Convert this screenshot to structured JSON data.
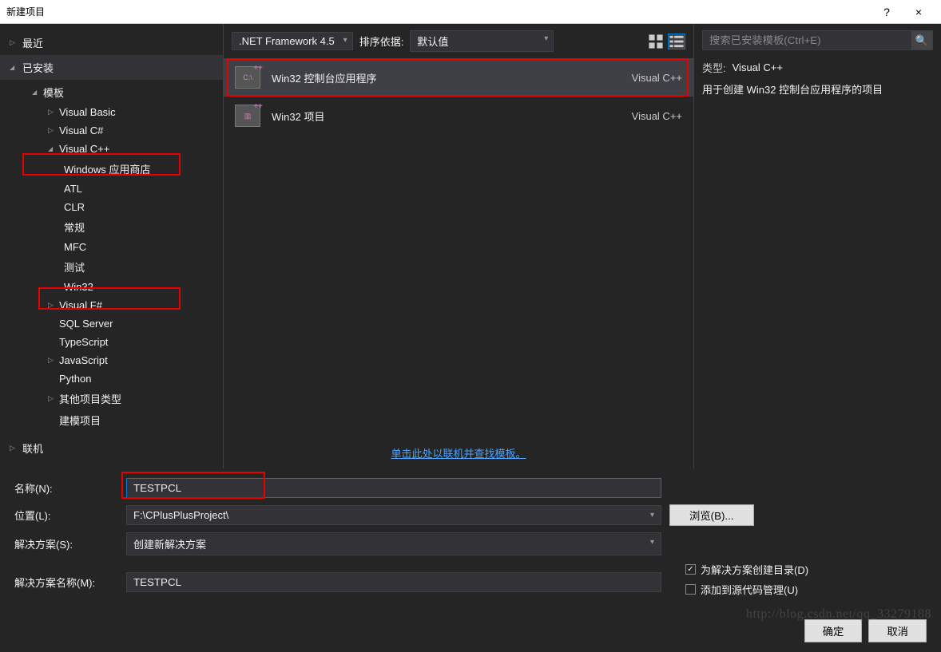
{
  "titlebar": {
    "title": "新建项目",
    "help": "?",
    "close": "×"
  },
  "sidebar": {
    "recent": "最近",
    "installed": "已安装",
    "templates": "模板",
    "items": {
      "vb": "Visual Basic",
      "cs": "Visual C#",
      "cpp": "Visual C++",
      "cpp_children": {
        "store": "Windows 应用商店",
        "atl": "ATL",
        "clr": "CLR",
        "general": "常规",
        "mfc": "MFC",
        "test": "测试",
        "win32": "Win32"
      },
      "fs": "Visual F#",
      "sql": "SQL Server",
      "ts": "TypeScript",
      "js": "JavaScript",
      "py": "Python",
      "other": "其他项目类型",
      "modeling": "建模项目"
    },
    "online": "联机"
  },
  "toolbar": {
    "framework": ".NET Framework 4.5",
    "sort_label": "排序依据:",
    "sort_value": "默认值"
  },
  "templates": {
    "t1": {
      "name": "Win32 控制台应用程序",
      "lang": "Visual C++"
    },
    "t2": {
      "name": "Win32 项目",
      "lang": "Visual C++"
    }
  },
  "online_link": "单击此处以联机并查找模板。",
  "right": {
    "search_placeholder": "搜索已安装模板(Ctrl+E)",
    "type_label": "类型:",
    "type_value": "Visual C++",
    "description": "用于创建 Win32 控制台应用程序的项目"
  },
  "form": {
    "name_label": "名称(N):",
    "name_value": "TESTPCL",
    "location_label": "位置(L):",
    "location_value": "F:\\CPlusPlusProject\\",
    "browse": "浏览(B)...",
    "solution_label": "解决方案(S):",
    "solution_value": "创建新解决方案",
    "solname_label": "解决方案名称(M):",
    "solname_value": "TESTPCL",
    "chk_createdir": "为解决方案创建目录(D)",
    "chk_sourcectrl": "添加到源代码管理(U)"
  },
  "buttons": {
    "ok": "确定",
    "cancel": "取消"
  },
  "watermark": "http://blog.csdn.net/qq_33279188"
}
